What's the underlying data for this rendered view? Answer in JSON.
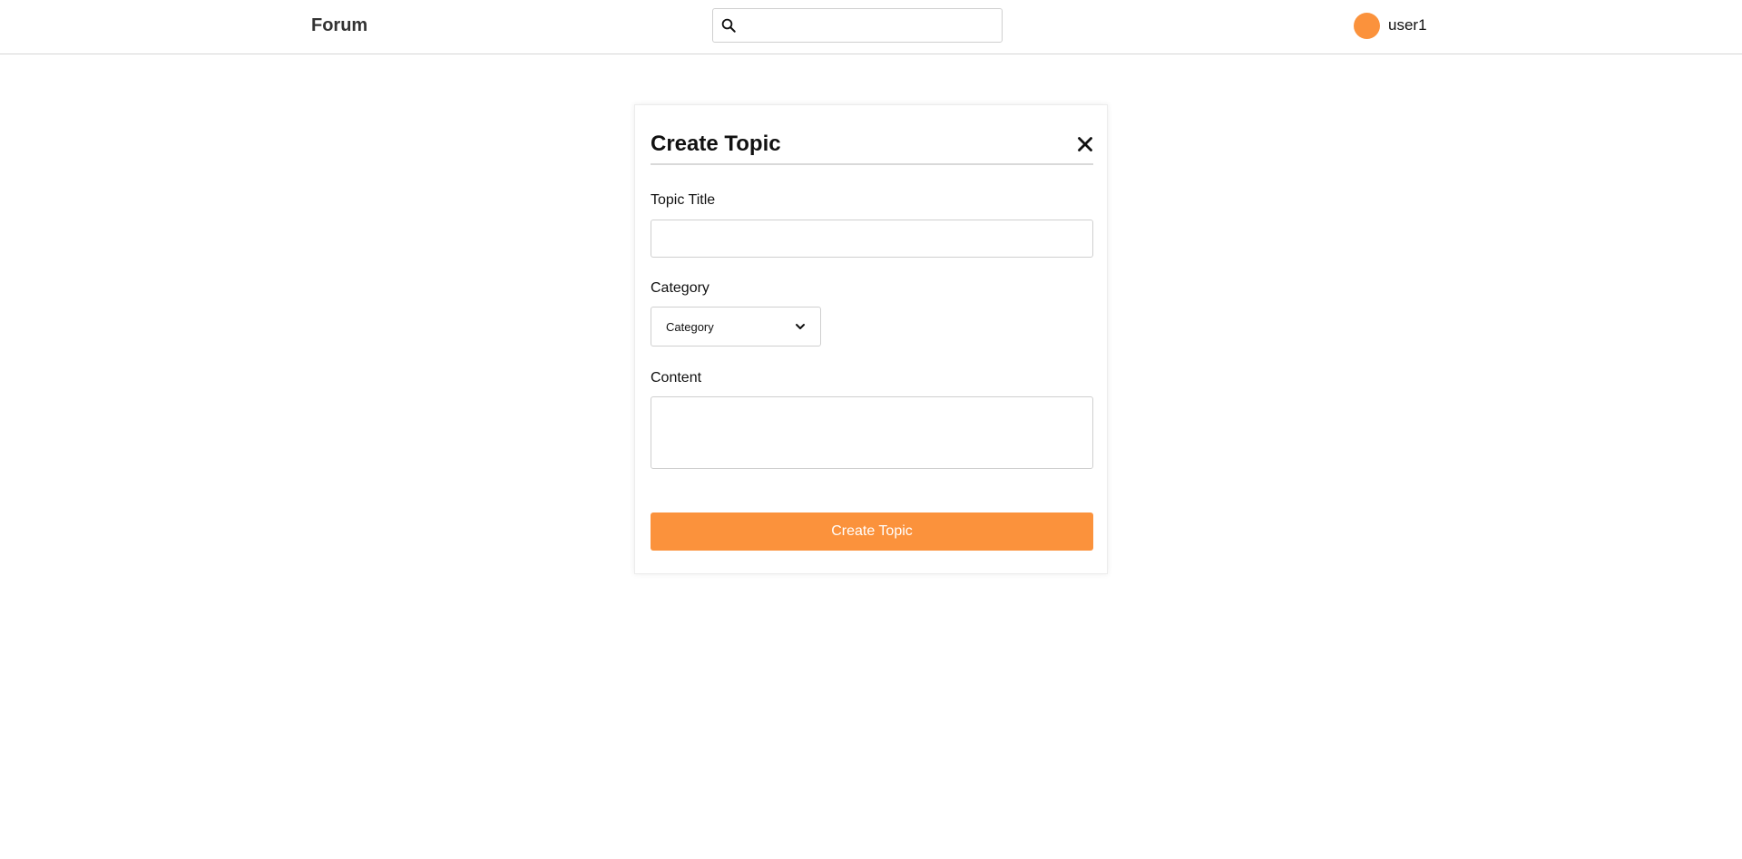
{
  "header": {
    "brand": "Forum",
    "search": {
      "value": "",
      "placeholder": "",
      "icon": "search-icon"
    },
    "user": {
      "name": "user1",
      "avatar_color": "#fb923c"
    }
  },
  "create_topic": {
    "title": "Create Topic",
    "close_icon": "close-icon",
    "fields": {
      "topic_title": {
        "label": "Topic Title",
        "value": "",
        "placeholder": ""
      },
      "category": {
        "label": "Category",
        "selected": "Category"
      },
      "content": {
        "label": "Content",
        "value": "",
        "placeholder": ""
      }
    },
    "submit_label": "Create Topic"
  },
  "colors": {
    "accent": "#fb923c",
    "border": "#cfcfcf",
    "text": "#111111"
  }
}
